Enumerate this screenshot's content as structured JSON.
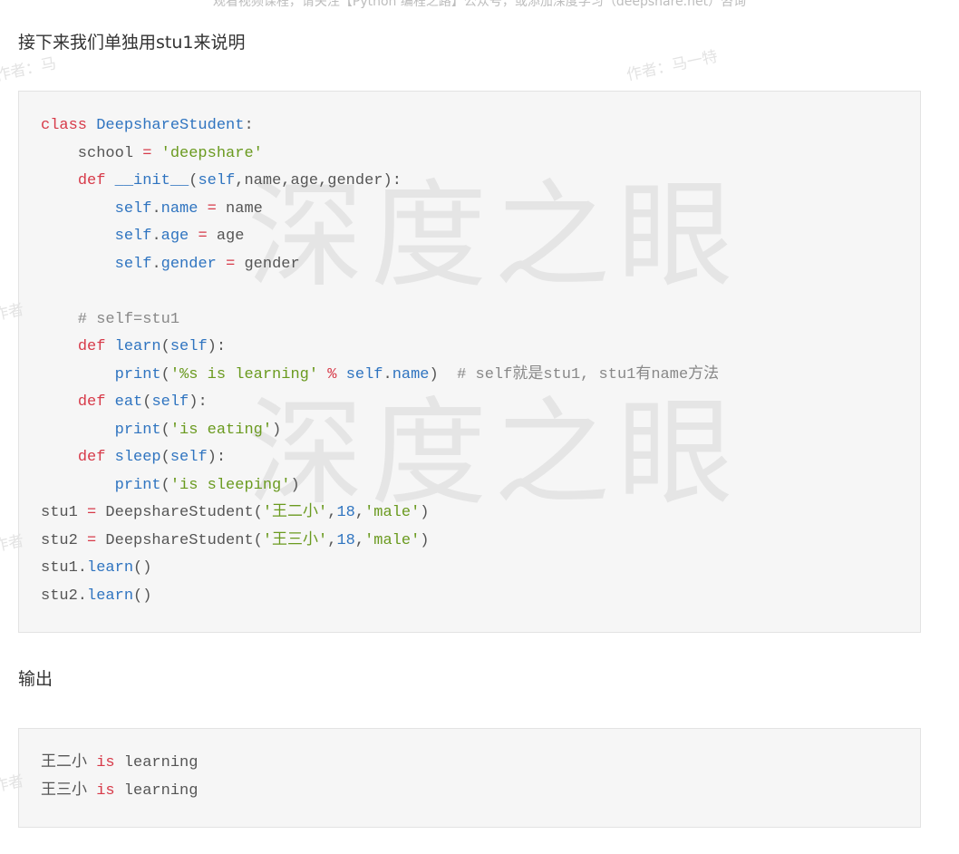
{
  "top_note": "观看视频课程，请关注【Python 编程之路】公众号，或添加深度学习（deepshare.net）咨询",
  "watermarks": {
    "author": "作者：马一特",
    "author_partial": "作者：马",
    "author_fragment": "作者",
    "site": "深度之眼"
  },
  "intro_text": "接下来我们单独用stu1来说明",
  "output_heading": "输出",
  "code_main": [
    [
      {
        "t": "class ",
        "c": "kw"
      },
      {
        "t": "DeepshareStudent",
        "c": "cls"
      },
      {
        "t": ":",
        "c": ""
      }
    ],
    [
      {
        "t": "    school ",
        "c": ""
      },
      {
        "t": "=",
        "c": "op"
      },
      {
        "t": " ",
        "c": ""
      },
      {
        "t": "'deepshare'",
        "c": "st"
      }
    ],
    [
      {
        "t": "    ",
        "c": ""
      },
      {
        "t": "def",
        "c": "kw"
      },
      {
        "t": " ",
        "c": ""
      },
      {
        "t": "__init__",
        "c": "cls"
      },
      {
        "t": "(",
        "c": ""
      },
      {
        "t": "self",
        "c": "cls"
      },
      {
        "t": ",name,age,gender):",
        "c": ""
      }
    ],
    [
      {
        "t": "        ",
        "c": ""
      },
      {
        "t": "self",
        "c": "cls"
      },
      {
        "t": ".",
        "c": ""
      },
      {
        "t": "name",
        "c": "cls"
      },
      {
        "t": " ",
        "c": ""
      },
      {
        "t": "=",
        "c": "op"
      },
      {
        "t": " name",
        "c": ""
      }
    ],
    [
      {
        "t": "        ",
        "c": ""
      },
      {
        "t": "self",
        "c": "cls"
      },
      {
        "t": ".",
        "c": ""
      },
      {
        "t": "age",
        "c": "cls"
      },
      {
        "t": " ",
        "c": ""
      },
      {
        "t": "=",
        "c": "op"
      },
      {
        "t": " age",
        "c": ""
      }
    ],
    [
      {
        "t": "        ",
        "c": ""
      },
      {
        "t": "self",
        "c": "cls"
      },
      {
        "t": ".",
        "c": ""
      },
      {
        "t": "gender",
        "c": "cls"
      },
      {
        "t": " ",
        "c": ""
      },
      {
        "t": "=",
        "c": "op"
      },
      {
        "t": " gender",
        "c": ""
      }
    ],
    [
      {
        "t": "",
        "c": ""
      }
    ],
    [
      {
        "t": "    # self=stu1",
        "c": "cm"
      }
    ],
    [
      {
        "t": "    ",
        "c": ""
      },
      {
        "t": "def",
        "c": "kw"
      },
      {
        "t": " ",
        "c": ""
      },
      {
        "t": "learn",
        "c": "cls"
      },
      {
        "t": "(",
        "c": ""
      },
      {
        "t": "self",
        "c": "cls"
      },
      {
        "t": "):",
        "c": ""
      }
    ],
    [
      {
        "t": "        ",
        "c": ""
      },
      {
        "t": "print",
        "c": "cls"
      },
      {
        "t": "(",
        "c": ""
      },
      {
        "t": "'%s is learning'",
        "c": "st"
      },
      {
        "t": " ",
        "c": ""
      },
      {
        "t": "%",
        "c": "op"
      },
      {
        "t": " ",
        "c": ""
      },
      {
        "t": "self",
        "c": "cls"
      },
      {
        "t": ".",
        "c": ""
      },
      {
        "t": "name",
        "c": "cls"
      },
      {
        "t": ")  ",
        "c": ""
      },
      {
        "t": "# self就是stu1, stu1有name方法",
        "c": "cm"
      }
    ],
    [
      {
        "t": "    ",
        "c": ""
      },
      {
        "t": "def",
        "c": "kw"
      },
      {
        "t": " ",
        "c": ""
      },
      {
        "t": "eat",
        "c": "cls"
      },
      {
        "t": "(",
        "c": ""
      },
      {
        "t": "self",
        "c": "cls"
      },
      {
        "t": "):",
        "c": ""
      }
    ],
    [
      {
        "t": "        ",
        "c": ""
      },
      {
        "t": "print",
        "c": "cls"
      },
      {
        "t": "(",
        "c": ""
      },
      {
        "t": "'is eating'",
        "c": "st"
      },
      {
        "t": ")",
        "c": ""
      }
    ],
    [
      {
        "t": "    ",
        "c": ""
      },
      {
        "t": "def",
        "c": "kw"
      },
      {
        "t": " ",
        "c": ""
      },
      {
        "t": "sleep",
        "c": "cls"
      },
      {
        "t": "(",
        "c": ""
      },
      {
        "t": "self",
        "c": "cls"
      },
      {
        "t": "):",
        "c": ""
      }
    ],
    [
      {
        "t": "        ",
        "c": ""
      },
      {
        "t": "print",
        "c": "cls"
      },
      {
        "t": "(",
        "c": ""
      },
      {
        "t": "'is sleeping'",
        "c": "st"
      },
      {
        "t": ")",
        "c": ""
      }
    ],
    [
      {
        "t": "stu1 ",
        "c": ""
      },
      {
        "t": "=",
        "c": "op"
      },
      {
        "t": " DeepshareStudent(",
        "c": ""
      },
      {
        "t": "'王二小'",
        "c": "st"
      },
      {
        "t": ",",
        "c": ""
      },
      {
        "t": "18",
        "c": "num"
      },
      {
        "t": ",",
        "c": ""
      },
      {
        "t": "'male'",
        "c": "st"
      },
      {
        "t": ")",
        "c": ""
      }
    ],
    [
      {
        "t": "stu2 ",
        "c": ""
      },
      {
        "t": "=",
        "c": "op"
      },
      {
        "t": " DeepshareStudent(",
        "c": ""
      },
      {
        "t": "'王三小'",
        "c": "st"
      },
      {
        "t": ",",
        "c": ""
      },
      {
        "t": "18",
        "c": "num"
      },
      {
        "t": ",",
        "c": ""
      },
      {
        "t": "'male'",
        "c": "st"
      },
      {
        "t": ")",
        "c": ""
      }
    ],
    [
      {
        "t": "stu1.",
        "c": ""
      },
      {
        "t": "learn",
        "c": "cls"
      },
      {
        "t": "()",
        "c": ""
      }
    ],
    [
      {
        "t": "stu2.",
        "c": ""
      },
      {
        "t": "learn",
        "c": "cls"
      },
      {
        "t": "()",
        "c": ""
      }
    ]
  ],
  "code_output": [
    [
      {
        "t": "王二小 ",
        "c": ""
      },
      {
        "t": "is",
        "c": "kw"
      },
      {
        "t": " learning",
        "c": ""
      }
    ],
    [
      {
        "t": "王三小 ",
        "c": ""
      },
      {
        "t": "is",
        "c": "kw"
      },
      {
        "t": " learning",
        "c": ""
      }
    ]
  ],
  "colors": {
    "keyword": "#d73a49",
    "name": "#2f74c0",
    "string": "#6a9a1f",
    "comment": "#888888",
    "code_bg": "#f6f6f6"
  }
}
